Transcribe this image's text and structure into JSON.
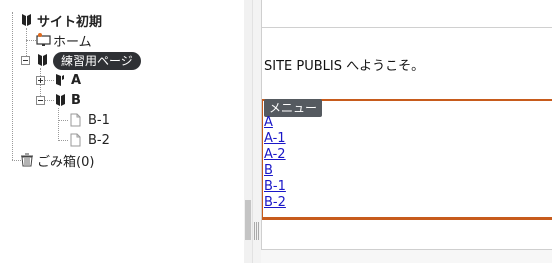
{
  "tree": {
    "root": {
      "label": "サイト初期"
    },
    "home": {
      "label": "ホーム"
    },
    "practice": {
      "label": "練習用ページ"
    },
    "a": {
      "label": "A"
    },
    "b": {
      "label": "B"
    },
    "b1": {
      "label": "B-1"
    },
    "b2": {
      "label": "B-2"
    },
    "trash": {
      "label": "ごみ箱(0)"
    }
  },
  "content": {
    "welcome": "SITE PUBLIS へようこそ。",
    "menu_tag": "メニュー",
    "menu_links": [
      "A",
      "A-1",
      "A-2",
      "B",
      "B-1",
      "B-2"
    ]
  },
  "colors": {
    "menu_border": "#c75b1c",
    "link": "#1a17c8",
    "tooltip_bg": "#2f3135"
  }
}
